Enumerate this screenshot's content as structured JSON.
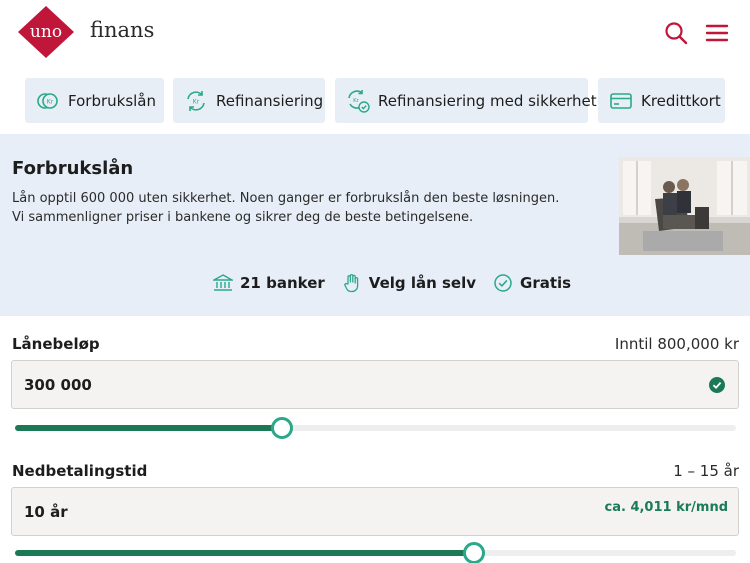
{
  "header": {
    "logo_text": "uno",
    "brand_text": "finans",
    "logo_color": "#c0163a",
    "icons": [
      "search-icon",
      "menu-icon"
    ]
  },
  "tabs": [
    {
      "label": "Forbrukslån",
      "icon": "coin-kr-icon"
    },
    {
      "label": "Refinansiering",
      "icon": "refresh-kr-icon"
    },
    {
      "label": "Refinansiering med sikkerhet",
      "icon": "refresh-secure-icon"
    },
    {
      "label": "Kredittkort",
      "icon": "credit-card-icon"
    }
  ],
  "hero": {
    "title": "Forbrukslån",
    "description": "Lån opptil 600 000 uten sikkerhet. Noen ganger er forbrukslån den beste løsningen. Vi sammenligner priser i bankene og sikrer deg de beste betingelsene.",
    "features": [
      {
        "label": "21 banker",
        "icon": "bank-icon"
      },
      {
        "label": "Velg lån selv",
        "icon": "hand-icon"
      },
      {
        "label": "Gratis",
        "icon": "check-circle-icon"
      }
    ],
    "background_color": "#e8eef8"
  },
  "loan_amount": {
    "label": "Lånebeløp",
    "hint": "Inntil 800,000 kr",
    "value": "300 000",
    "slider_fraction": 0.37
  },
  "repayment": {
    "label": "Nedbetalingstid",
    "hint": "1 – 15 år",
    "value": "10 år",
    "monthly": "ca. 4,011 kr/mnd",
    "slider_fraction": 0.637
  },
  "colors": {
    "accent_green": "#1b7a55",
    "thumb_border": "#2aa88a",
    "brand_red": "#c0163a",
    "tab_bg": "#e8eef6"
  }
}
